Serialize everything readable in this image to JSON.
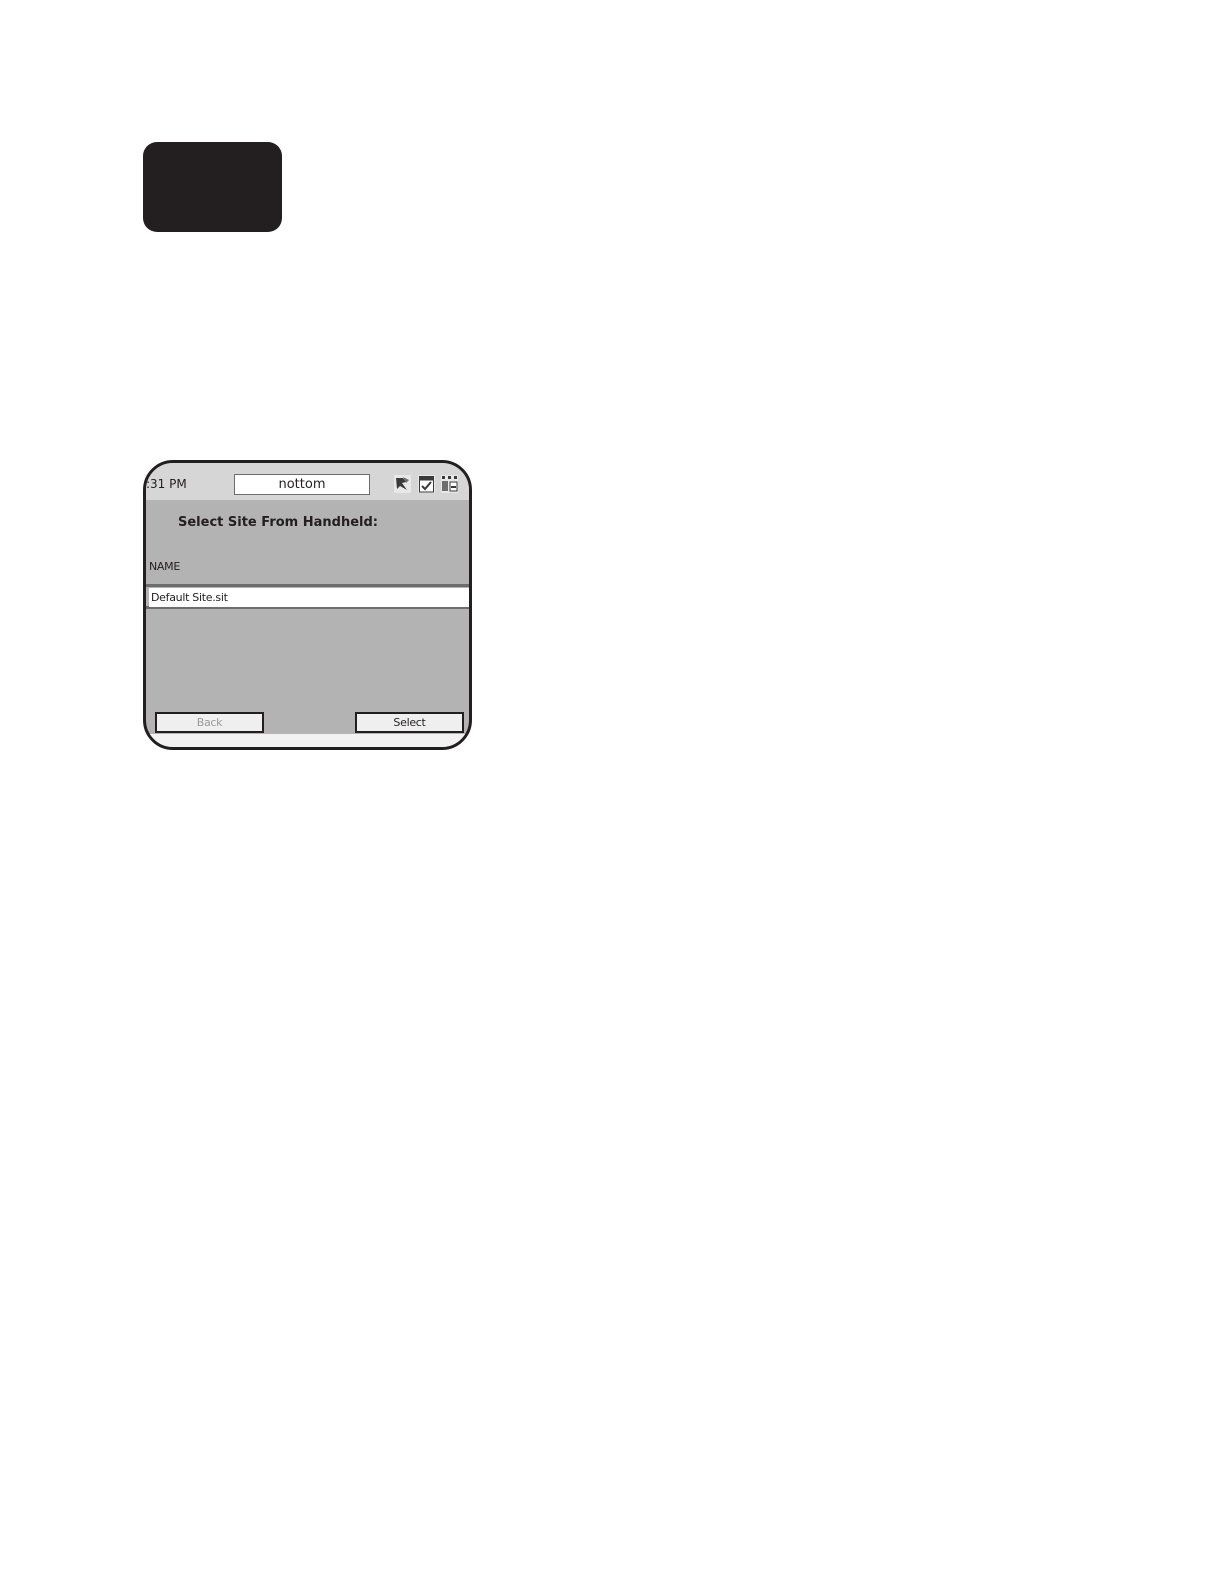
{
  "status_bar": {
    "time": ":31 PM",
    "user": "nottom",
    "icons": [
      "sync-icon",
      "checkbox-icon",
      "network-icon"
    ]
  },
  "screen": {
    "title": "Select Site From Handheld:",
    "column_header": "NAME",
    "items": [
      {
        "name": "Default Site.sit"
      }
    ]
  },
  "buttons": {
    "back_label": "Back",
    "select_label": "Select"
  }
}
